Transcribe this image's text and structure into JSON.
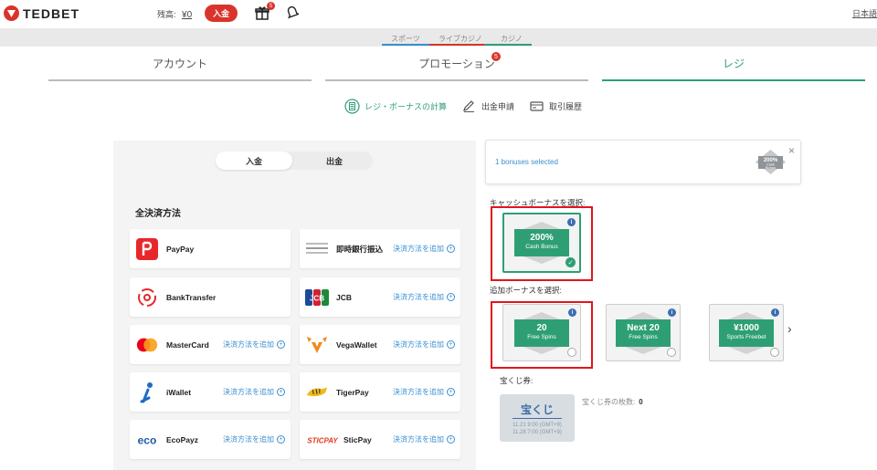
{
  "header": {
    "brand": "TEDBET",
    "balance_label": "残高:",
    "balance_value": "¥0",
    "deposit_label": "入金",
    "gift_badge": "5",
    "language": "日本語"
  },
  "product_nav": {
    "items": [
      {
        "label": "スポーツ",
        "color": "#3a8fd0"
      },
      {
        "label": "ライブカジノ",
        "color": "#d9342b"
      },
      {
        "label": "カジノ",
        "color": "#2e9f75"
      }
    ]
  },
  "account_tabs": {
    "items": [
      {
        "label": "アカウント",
        "active": false
      },
      {
        "label": "プロモーション",
        "active": false,
        "badge": "5"
      },
      {
        "label": "レジ",
        "active": true
      }
    ]
  },
  "cashier_links": {
    "items": [
      {
        "label": "レジ・ボーナスの計算",
        "icon": "calculator-icon",
        "active": true
      },
      {
        "label": "出金申請",
        "icon": "pencil-icon",
        "active": false
      },
      {
        "label": "取引履歴",
        "icon": "receipt-icon",
        "active": false
      }
    ]
  },
  "payment": {
    "tabs": {
      "deposit": "入金",
      "withdraw": "出金"
    },
    "section_title": "全決済方法",
    "add_label": "決済方法を追加",
    "methods": [
      {
        "name": "PayPay",
        "icon": "paypay-logo",
        "show_add": false
      },
      {
        "name": "即時銀行振込",
        "icon": "bank-stripes-logo",
        "show_add": true
      },
      {
        "name": "BankTransfer",
        "icon": "bank-transfer-logo",
        "show_add": false
      },
      {
        "name": "JCB",
        "icon": "jcb-logo",
        "show_add": true
      },
      {
        "name": "MasterCard",
        "icon": "mastercard-logo",
        "show_add": true
      },
      {
        "name": "VegaWallet",
        "icon": "vegawallet-logo",
        "show_add": true
      },
      {
        "name": "iWallet",
        "icon": "iwallet-logo",
        "show_add": true
      },
      {
        "name": "TigerPay",
        "icon": "tigerpay-logo",
        "show_add": true
      },
      {
        "name": "EcoPayz",
        "icon": "ecopayz-logo",
        "show_add": true
      },
      {
        "name": "SticPay",
        "icon": "sticpay-logo",
        "show_add": true
      }
    ],
    "logo_text": {
      "jcb": "JCB",
      "eco": "eco",
      "sticpay": "STICPAY"
    }
  },
  "bonus": {
    "selected_text": "1 bonuses selected",
    "selected_badge": {
      "big": "200%",
      "line1": "Cash",
      "line2": "Bonus"
    },
    "cash_label": "キャッシュボーナスを選択:",
    "cash_bonuses": [
      {
        "big": "200%",
        "small": "Cash Bonus",
        "selected": true
      }
    ],
    "extra_label": "追加ボーナスを選択:",
    "extra_bonuses": [
      {
        "big": "20",
        "small": "Free Spins",
        "selected": false
      },
      {
        "big": "Next 20",
        "small": "Free Spins",
        "selected": false
      },
      {
        "big": "¥1000",
        "small": "Sports Freebet",
        "selected": false
      }
    ],
    "info_glyph": "i",
    "check_glyph": "✓",
    "next_glyph": "›",
    "close_glyph": "×"
  },
  "lottery": {
    "label": "宝くじ券:",
    "ticket_title": "宝くじ",
    "date1": "11.21 9:00 (GMT+9)",
    "date2": "11.28 7:00 (GMT+9)",
    "count_label": "宝くじ券の枚数:",
    "count_value": "0"
  },
  "colors": {
    "accent": "#2e9f75",
    "brand_red": "#d9342b",
    "link_blue": "#3a8fd0",
    "highlight_red": "#e0161e"
  }
}
